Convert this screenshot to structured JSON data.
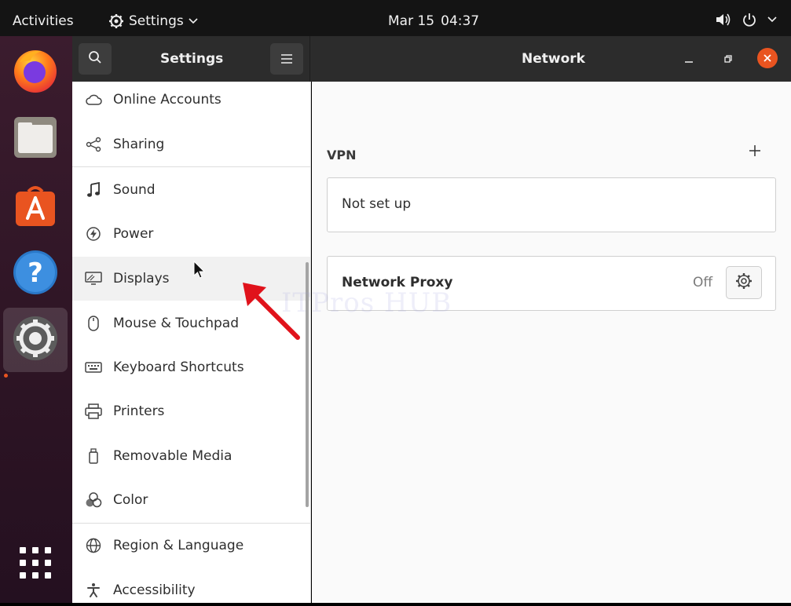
{
  "topbar": {
    "activities": "Activities",
    "app_name": "Settings",
    "date": "Mar 15",
    "time": "04:37"
  },
  "dock": {
    "apps": [
      "firefox-icon",
      "files-icon",
      "software-icon",
      "help-icon",
      "settings-icon"
    ],
    "active": "settings-icon"
  },
  "header": {
    "sidebar_title": "Settings",
    "panel_title": "Network"
  },
  "sidebar": {
    "items": [
      {
        "label": "Online Accounts",
        "icon": "cloud-icon"
      },
      {
        "label": "Sharing",
        "icon": "share-icon"
      },
      {
        "label": "Sound",
        "icon": "music-note-icon"
      },
      {
        "label": "Power",
        "icon": "power-icon"
      },
      {
        "label": "Displays",
        "icon": "display-icon"
      },
      {
        "label": "Mouse & Touchpad",
        "icon": "mouse-icon"
      },
      {
        "label": "Keyboard Shortcuts",
        "icon": "keyboard-icon"
      },
      {
        "label": "Printers",
        "icon": "printer-icon"
      },
      {
        "label": "Removable Media",
        "icon": "removable-media-icon"
      },
      {
        "label": "Color",
        "icon": "color-icon"
      },
      {
        "label": "Region & Language",
        "icon": "globe-icon"
      },
      {
        "label": "Accessibility",
        "icon": "accessibility-icon"
      }
    ]
  },
  "network": {
    "vpn_heading": "VPN",
    "vpn_status": "Not set up",
    "proxy_label": "Network Proxy",
    "proxy_state": "Off"
  },
  "watermark": "ITPros HUB",
  "colors": {
    "accent": "#e95420",
    "topbar": "#141414",
    "header": "#2c2c2c",
    "arrow": "#e0121b"
  }
}
